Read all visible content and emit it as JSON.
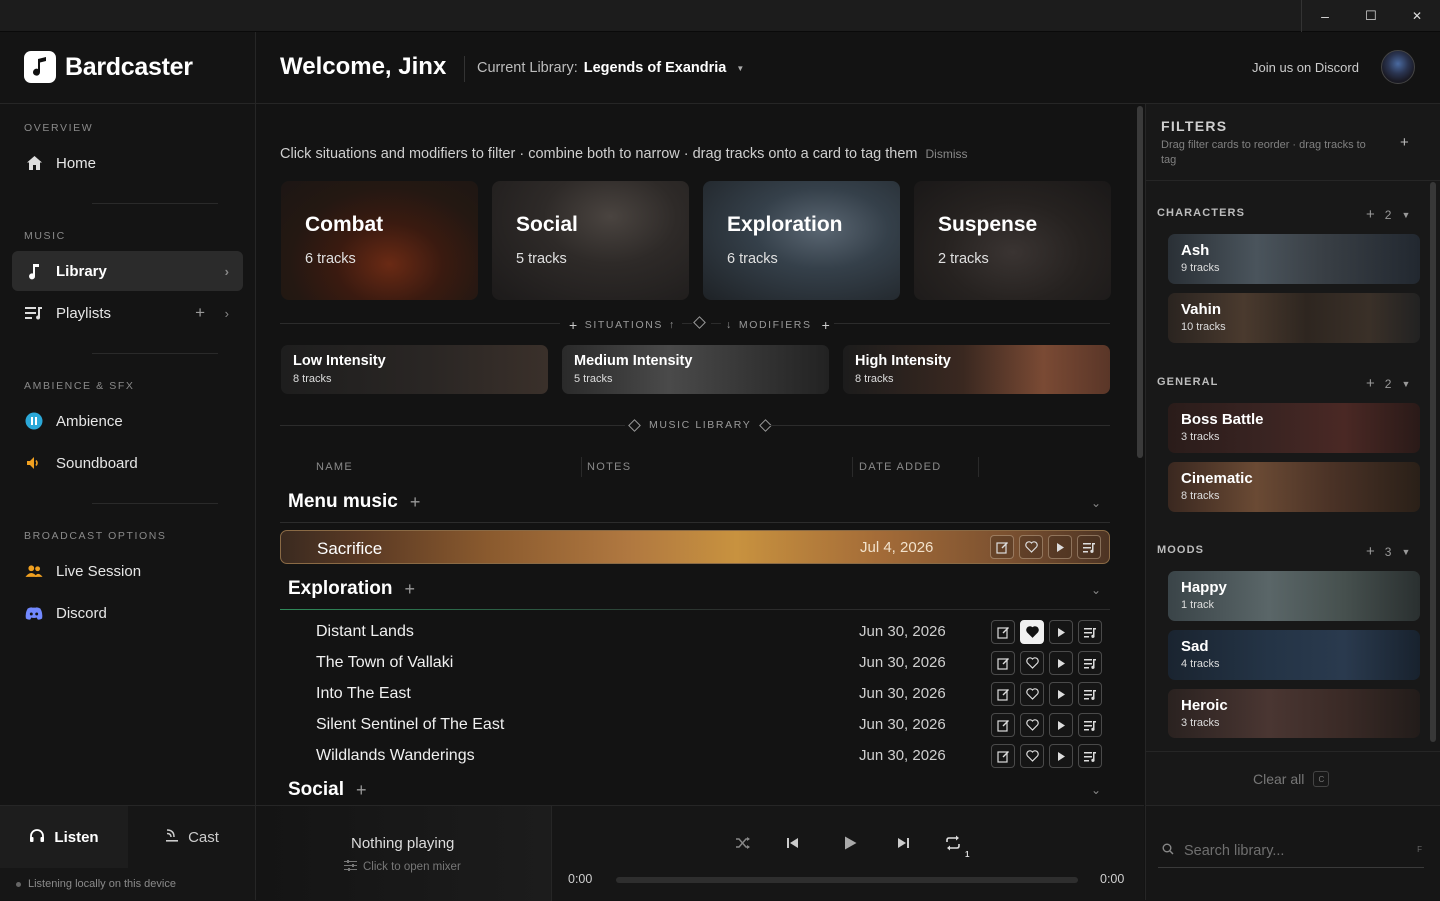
{
  "window": {
    "minimize": "–",
    "maximize": "☐",
    "close": "✕"
  },
  "app": {
    "name": "Bardcaster"
  },
  "header": {
    "welcome": "Welcome, Jinx",
    "current_library_label": "Current Library:",
    "current_library": "Legends of Exandria",
    "discord_link": "Join us on Discord"
  },
  "sidebar": {
    "overview_label": "OVERVIEW",
    "home": "Home",
    "music_label": "MUSIC",
    "library": "Library",
    "playlists": "Playlists",
    "ambience_label": "AMBIENCE & SFX",
    "ambience": "Ambience",
    "soundboard": "Soundboard",
    "broadcast_label": "BROADCAST OPTIONS",
    "live_session": "Live Session",
    "discord": "Discord",
    "listen": "Listen",
    "cast": "Cast",
    "local_note": "Listening locally on this device"
  },
  "main": {
    "hint": "Click situations and modifiers to filter · combine both to narrow · drag tracks onto a card to tag them",
    "dismiss": "Dismiss",
    "situations": [
      {
        "title": "Combat",
        "count": "6 tracks"
      },
      {
        "title": "Social",
        "count": "5 tracks"
      },
      {
        "title": "Exploration",
        "count": "6 tracks"
      },
      {
        "title": "Suspense",
        "count": "2 tracks"
      }
    ],
    "situations_label": "SITUATIONS",
    "modifiers_label": "MODIFIERS",
    "modifiers": [
      {
        "title": "Low Intensity",
        "count": "8 tracks"
      },
      {
        "title": "Medium Intensity",
        "count": "5 tracks"
      },
      {
        "title": "High Intensity",
        "count": "8 tracks"
      }
    ],
    "library_label": "MUSIC LIBRARY",
    "columns": {
      "name": "NAME",
      "notes": "NOTES",
      "date": "DATE ADDED"
    },
    "groups": [
      {
        "name": "Menu music"
      },
      {
        "name": "Exploration"
      },
      {
        "name": "Social"
      }
    ],
    "highlighted_track": {
      "name": "Sacrifice",
      "date": "Jul 4, 2026"
    },
    "tracks": [
      {
        "name": "Distant Lands",
        "date": "Jun 30, 2026",
        "favorite": true
      },
      {
        "name": "The Town of Vallaki",
        "date": "Jun 30, 2026",
        "favorite": false
      },
      {
        "name": "Into The East",
        "date": "Jun 30, 2026",
        "favorite": false
      },
      {
        "name": "Silent Sentinel of The East",
        "date": "Jun 30, 2026",
        "favorite": false
      },
      {
        "name": "Wildlands Wanderings",
        "date": "Jun 30, 2026",
        "favorite": false
      }
    ]
  },
  "filters": {
    "title": "FILTERS",
    "subtitle": "Drag filter cards to reorder · drag tracks to tag",
    "sections": [
      {
        "name": "CHARACTERS",
        "count": "2",
        "cards": [
          {
            "name": "Ash",
            "count": "9 tracks"
          },
          {
            "name": "Vahin",
            "count": "10 tracks"
          }
        ]
      },
      {
        "name": "GENERAL",
        "count": "2",
        "cards": [
          {
            "name": "Boss Battle",
            "count": "3 tracks"
          },
          {
            "name": "Cinematic",
            "count": "8 tracks"
          }
        ]
      },
      {
        "name": "MOODS",
        "count": "3",
        "cards": [
          {
            "name": "Happy",
            "count": "1 track"
          },
          {
            "name": "Sad",
            "count": "4 tracks"
          },
          {
            "name": "Heroic",
            "count": "3 tracks"
          }
        ]
      }
    ],
    "clear_all": "Clear all",
    "clear_key": "C"
  },
  "player": {
    "title": "Nothing playing",
    "subtitle": "Click to open mixer",
    "time_current": "0:00",
    "time_total": "0:00",
    "progress": 0,
    "repeat_count": "1"
  },
  "search": {
    "placeholder": "Search library...",
    "key": "F"
  }
}
